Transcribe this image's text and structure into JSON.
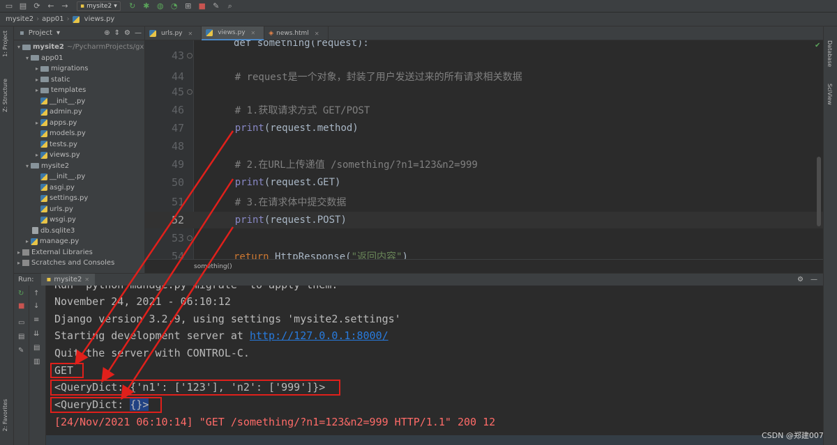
{
  "toolbar": {
    "run_config": "mysite2"
  },
  "navbar": {
    "crumbs": [
      "mysite2",
      "app01",
      "views.py"
    ]
  },
  "left_stripe": {
    "project_tab": "1: Project",
    "structure_tab": "Z: Structure",
    "favorites_tab": "2: Favorites"
  },
  "right_stripe": {
    "database_tab": "Database",
    "sciview_tab": "SciView"
  },
  "project_panel": {
    "title": "Project",
    "items": [
      {
        "label": "mysite2",
        "path": "~/PycharmProjects/gx"
      },
      {
        "label": "app01"
      },
      {
        "label": "migrations"
      },
      {
        "label": "static"
      },
      {
        "label": "templates"
      },
      {
        "label": "__init__.py"
      },
      {
        "label": "admin.py"
      },
      {
        "label": "apps.py"
      },
      {
        "label": "models.py"
      },
      {
        "label": "tests.py"
      },
      {
        "label": "views.py"
      },
      {
        "label": "mysite2"
      },
      {
        "label": "__init__.py"
      },
      {
        "label": "asgi.py"
      },
      {
        "label": "settings.py"
      },
      {
        "label": "urls.py"
      },
      {
        "label": "wsgi.py"
      },
      {
        "label": "db.sqlite3"
      },
      {
        "label": "manage.py"
      },
      {
        "label": "External Libraries"
      },
      {
        "label": "Scratches and Consoles"
      }
    ]
  },
  "editor_tabs": [
    {
      "label": "urls.py"
    },
    {
      "label": "views.py"
    },
    {
      "label": "news.html"
    }
  ],
  "editor": {
    "lines": [
      {
        "num": "43",
        "text": "def something(request):"
      },
      {
        "num": "44",
        "text": "    # request是一个对象，封装了用户发送过来的所有请求相关数据"
      },
      {
        "num": "45",
        "text": ""
      },
      {
        "num": "46",
        "text": "    # 1.获取请求方式 GET/POST"
      },
      {
        "num": "47",
        "text_a": "    ",
        "fn": "print",
        "text_b": "(request.method)"
      },
      {
        "num": "48",
        "text": ""
      },
      {
        "num": "49",
        "text": "    # 2.在URL上传递值 /something/?n1=123&n2=999"
      },
      {
        "num": "50",
        "text_a": "    ",
        "fn": "print",
        "text_b": "(request.GET)"
      },
      {
        "num": "51",
        "text": "    # 3.在请求体中提交数据"
      },
      {
        "num": "52",
        "text_a": "    ",
        "fn": "print",
        "text_b": "(request.POST)"
      },
      {
        "num": "53",
        "text": ""
      },
      {
        "num": "54",
        "kw": "return",
        "text_b": " HttpResponse(",
        "str": "\"返回内容\"",
        "text_c": ")"
      }
    ],
    "breadcrumb": "something()"
  },
  "run_panel": {
    "label": "Run:",
    "tab": "mysite2",
    "console": [
      "Run 'python manage.py migrate' to apply them.",
      "November 24, 2021 - 06:10:12",
      "Django version 3.2.9, using settings 'mysite2.settings'",
      "Starting development server at ",
      "http://127.0.0.1:8000/",
      "Quit the server with CONTROL-C.",
      "GET",
      "<QueryDict: {'n1': ['123'], 'n2': ['999']}>",
      "<QueryDict: ",
      "{}>",
      "[24/Nov/2021 06:10:14] \"GET /something/?n1=123&n2=999 HTTP/1.1\" 200 12"
    ]
  },
  "watermark": "CSDN @郑建007",
  "colors": {
    "annotation_red": "#e0201b",
    "comment": "#808080",
    "keyword": "#cc7832",
    "builtin": "#8888c6",
    "link": "#287bde",
    "error": "#ff6b68"
  }
}
